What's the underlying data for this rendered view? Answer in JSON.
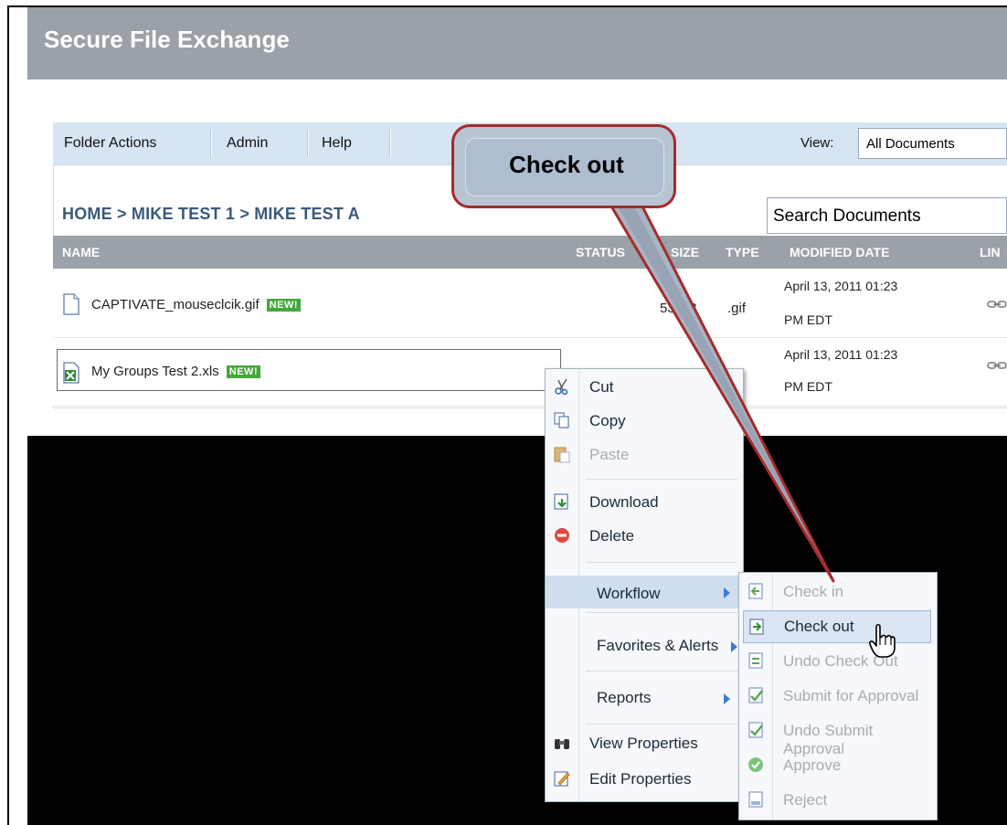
{
  "app": {
    "title": "Secure File Exchange"
  },
  "toolbar": {
    "items": [
      "Folder Actions",
      "Admin",
      "Help"
    ],
    "view_label": "View:",
    "view_value": "All Documents"
  },
  "breadcrumb": "HOME  >  MIKE TEST 1  >  MIKE TEST A",
  "search": {
    "value": "Search Documents"
  },
  "table": {
    "headers": [
      "NAME",
      "STATUS",
      "SIZE",
      "TYPE",
      "MODIFIED DATE",
      "LIN"
    ],
    "rows": [
      {
        "name": "CAPTIVATE_mouseclcik.gif",
        "badge": "NEW!",
        "size": "53 KB",
        "type": ".gif",
        "date": "April 13, 2011 01:23",
        "date2": "PM EDT"
      },
      {
        "name": "My Groups Test 2.xls",
        "badge": "NEW!",
        "size": "",
        "type": "",
        "date": "April 13, 2011 01:23",
        "date2": "PM EDT"
      }
    ]
  },
  "context_menu": {
    "items": [
      "Cut",
      "Copy",
      "Paste",
      "Download",
      "Delete",
      "Workflow",
      "Favorites & Alerts",
      "Reports",
      "View Properties",
      "Edit Properties"
    ]
  },
  "submenu": {
    "items": [
      "Check in",
      "Check out",
      "Undo Check Out",
      "Submit for Approval",
      "Undo Submit Approval",
      "Approve",
      "Reject"
    ]
  },
  "callout": {
    "text": "Check out"
  },
  "colors": {
    "accent": "#3d7bd4",
    "callout_border": "#a62b2b",
    "header": "#9aa1a8",
    "toolbar": "#d6e4f4"
  }
}
